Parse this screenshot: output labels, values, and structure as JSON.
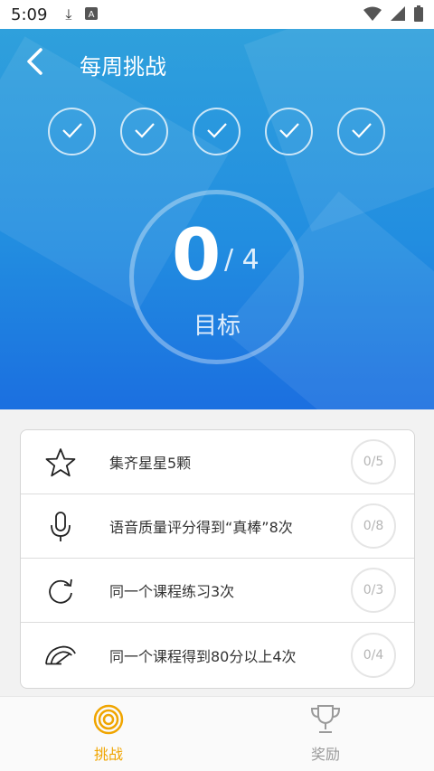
{
  "status_bar": {
    "time": "5:09"
  },
  "header": {
    "title": "每周挑战"
  },
  "checkmarks": [
    {
      "done": true
    },
    {
      "done": true
    },
    {
      "done": true
    },
    {
      "done": true
    },
    {
      "done": true
    }
  ],
  "progress": {
    "current": "0",
    "total": "/ 4",
    "label": "目标"
  },
  "tasks": [
    {
      "label": "集齐星星5颗",
      "status": "0/5",
      "icon": "star-icon"
    },
    {
      "label": "语音质量评分得到“真棒”8次",
      "status": "0/8",
      "icon": "microphone-icon"
    },
    {
      "label": "同一个课程练习3次",
      "status": "0/3",
      "icon": "refresh-icon"
    },
    {
      "label": "同一个课程得到80分以上4次",
      "status": "0/4",
      "icon": "speedometer-icon"
    }
  ],
  "tabs": [
    {
      "label": "挑战",
      "icon": "target-icon",
      "active": true
    },
    {
      "label": "奖励",
      "icon": "trophy-icon",
      "active": false
    }
  ],
  "colors": {
    "accent": "#f0a500",
    "hero_top": "#2fa0dc",
    "hero_bottom": "#1b6fe0"
  }
}
